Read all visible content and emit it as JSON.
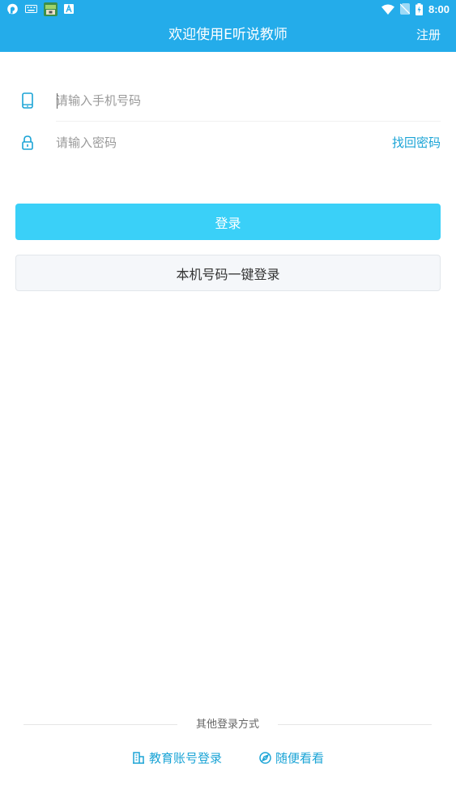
{
  "status_bar": {
    "time": "8:00",
    "left_icons": [
      "chat-notification-icon",
      "keyboard-icon",
      "app-notification-icon",
      "text-a-icon"
    ],
    "right_icons": [
      "wifi-icon",
      "no-sim-icon",
      "battery-icon"
    ]
  },
  "app_bar": {
    "title": "欢迎使用E听说教师",
    "register_label": "注册",
    "color": "#24acea"
  },
  "form": {
    "phone": {
      "icon": "phone-icon",
      "placeholder": "请输入手机号码",
      "value": ""
    },
    "password": {
      "icon": "lock-icon",
      "placeholder": "请输入密码",
      "value": ""
    },
    "forgot_label": "找回密码"
  },
  "buttons": {
    "login_label": "登录",
    "onekey_label": "本机号码一键登录",
    "login_color": "#3ad0f8"
  },
  "other_login": {
    "heading": "其他登录方式",
    "options": [
      {
        "icon": "school-building-icon",
        "label": "教育账号登录"
      },
      {
        "icon": "compass-icon",
        "label": "随便看看"
      }
    ],
    "accent": "#1ba4d6"
  }
}
